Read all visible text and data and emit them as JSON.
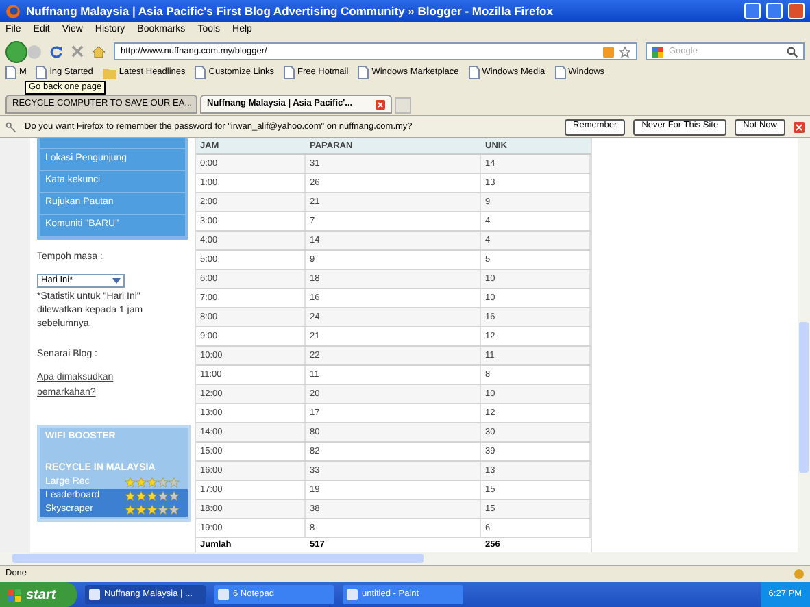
{
  "window": {
    "title": "Nuffnang Malaysia | Asia Pacific's First Blog Advertising Community » Blogger - Mozilla Firefox"
  },
  "menu": [
    "File",
    "Edit",
    "View",
    "History",
    "Bookmarks",
    "Tools",
    "Help"
  ],
  "address": {
    "value": "http://www.nuffnang.com.my/blogger/"
  },
  "search": {
    "placeholder": "Google"
  },
  "bookmarks": [
    {
      "label": "M",
      "kind": "page"
    },
    {
      "label": "ing Started",
      "kind": "page"
    },
    {
      "label": "Latest Headlines",
      "kind": "feed"
    },
    {
      "label": "Customize Links",
      "kind": "page"
    },
    {
      "label": "Free Hotmail",
      "kind": "page"
    },
    {
      "label": "Windows Marketplace",
      "kind": "page"
    },
    {
      "label": "Windows Media",
      "kind": "page"
    },
    {
      "label": "Windows",
      "kind": "page"
    }
  ],
  "tooltip": "Go back one page",
  "tabs": [
    {
      "label": "RECYCLE COMPUTER TO SAVE OUR EA...",
      "selected": false
    },
    {
      "label": "Nuffnang Malaysia | Asia Pacific'...",
      "selected": true
    }
  ],
  "password_bar": {
    "message": "Do you want Firefox to remember the password for \"irwan_alif@yahoo.com\" on nuffnang.com.my?",
    "buttons": [
      "Remember",
      "Never For This Site",
      "Not Now"
    ]
  },
  "sidebar": {
    "items": [
      "Lokasi Pengunjung",
      "Kata kekunci",
      "Rujukan Pautan",
      "Komuniti \"BARU\""
    ],
    "period_label": "Tempoh masa :",
    "period_value": "Hari Ini*",
    "note": "*Statistik untuk \"Hari Ini\" dilewatkan kepada 1 jam sebelumnya.",
    "blog_label": "Senarai Blog :",
    "help_link": "Apa dimaksudkan pemarkahan?"
  },
  "ad": {
    "sections": [
      {
        "title": "WIFI BOOSTER"
      },
      {
        "title": "RECYCLE IN MALAYSIA",
        "rows": [
          {
            "label": "Large Rec",
            "stars": 3
          },
          {
            "label": "Leaderboard",
            "stars": 3
          },
          {
            "label": "Skyscraper",
            "stars": 3
          }
        ]
      }
    ]
  },
  "table": {
    "columns": [
      "JAM",
      "PAPARAN",
      "UNIK"
    ],
    "rows": [
      [
        "0:00",
        "31",
        "14"
      ],
      [
        "1:00",
        "26",
        "13"
      ],
      [
        "2:00",
        "21",
        "9"
      ],
      [
        "3:00",
        "7",
        "4"
      ],
      [
        "4:00",
        "14",
        "4"
      ],
      [
        "5:00",
        "9",
        "5"
      ],
      [
        "6:00",
        "18",
        "10"
      ],
      [
        "7:00",
        "16",
        "10"
      ],
      [
        "8:00",
        "24",
        "16"
      ],
      [
        "9:00",
        "21",
        "12"
      ],
      [
        "10:00",
        "22",
        "11"
      ],
      [
        "11:00",
        "11",
        "8"
      ],
      [
        "12:00",
        "20",
        "10"
      ],
      [
        "13:00",
        "17",
        "12"
      ],
      [
        "14:00",
        "80",
        "30"
      ],
      [
        "15:00",
        "82",
        "39"
      ],
      [
        "16:00",
        "33",
        "13"
      ],
      [
        "17:00",
        "19",
        "15"
      ],
      [
        "18:00",
        "38",
        "15"
      ],
      [
        "19:00",
        "8",
        "6"
      ]
    ],
    "total": [
      "Jumlah",
      "517",
      "256"
    ]
  },
  "status_bar": "Done",
  "taskbar": {
    "start": "start",
    "items": [
      {
        "label": "Nuffnang Malaysia | ...",
        "selected": true
      },
      {
        "label": "6 Notepad",
        "selected": false
      },
      {
        "label": "untitled - Paint",
        "selected": false
      }
    ],
    "clock": "6:27 PM"
  }
}
